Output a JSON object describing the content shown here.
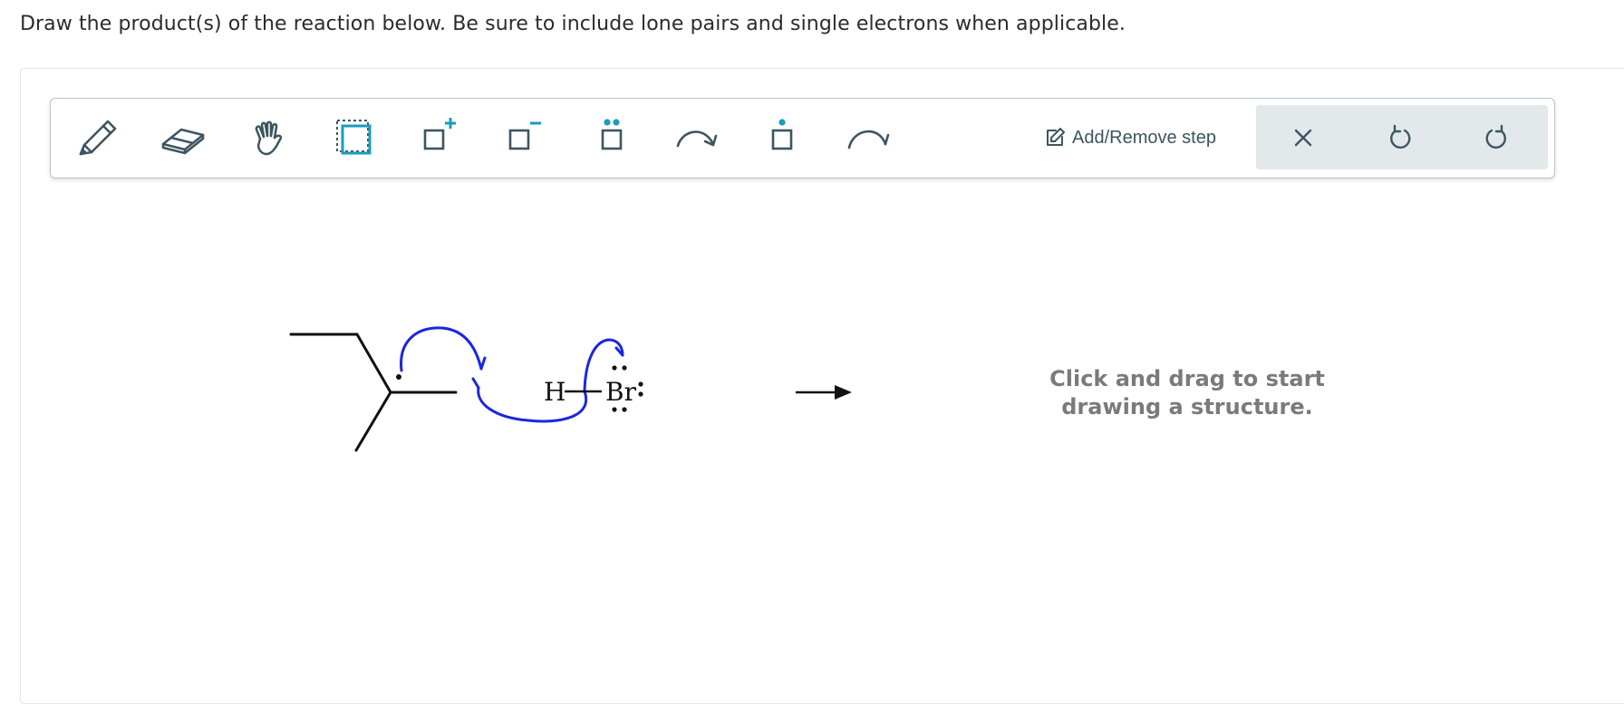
{
  "question": {
    "prompt": "Draw the product(s) of the reaction below. Be sure to include lone pairs and single electrons when applicable."
  },
  "toolbar": {
    "tools": [
      {
        "icon": "pencil-icon"
      },
      {
        "icon": "eraser-icon"
      },
      {
        "icon": "hand-icon"
      },
      {
        "icon": "select-box-icon"
      },
      {
        "icon": "add-positive-charge-icon"
      },
      {
        "icon": "add-negative-charge-icon"
      },
      {
        "icon": "lone-pair-icon"
      },
      {
        "icon": "curved-arrow-two-electron-icon"
      },
      {
        "icon": "single-electron-icon"
      },
      {
        "icon": "curved-arrow-one-electron-icon"
      }
    ],
    "step_label": "Add/Remove step",
    "actions": [
      {
        "icon": "clear-icon"
      },
      {
        "icon": "undo-icon"
      },
      {
        "icon": "redo-icon"
      }
    ],
    "accent_color": "#1a9bbf",
    "icon_color": "#3d5561"
  },
  "reaction": {
    "h_label": "H",
    "br_label": "Br",
    "arrow_color": "#1a26e0"
  },
  "answer_area": {
    "hint_line1": "Click and drag to start",
    "hint_line2": "drawing a structure."
  }
}
